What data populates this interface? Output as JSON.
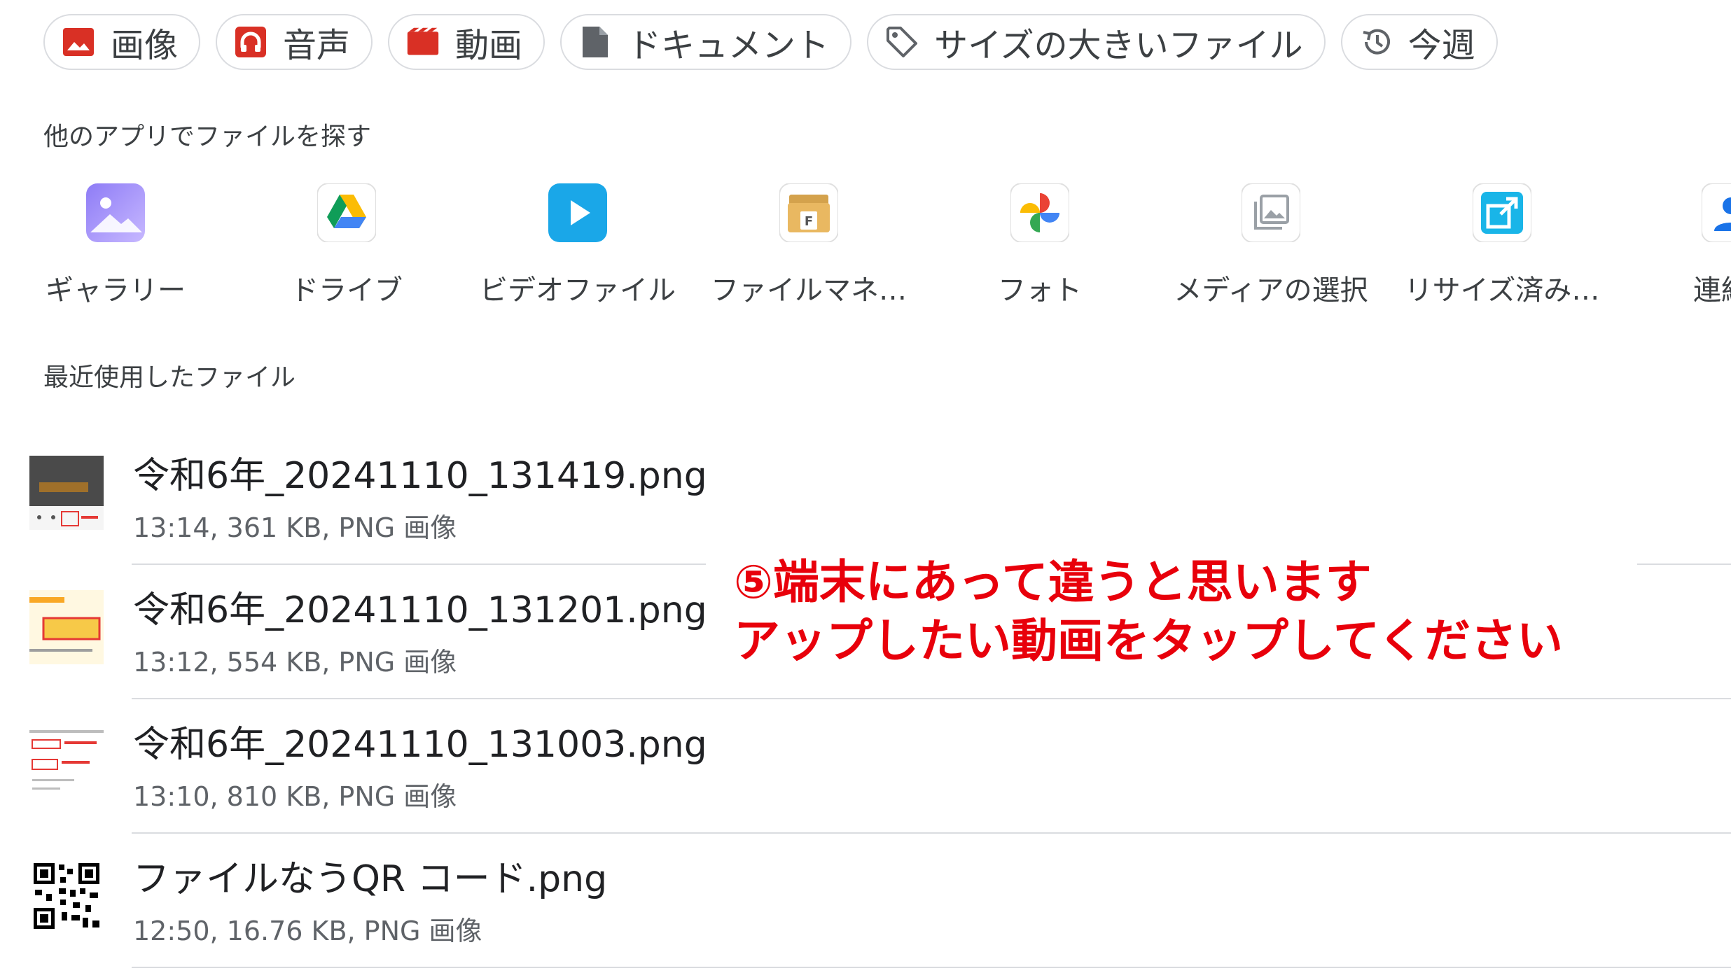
{
  "chips": [
    {
      "label": "画像",
      "icon": "image-icon"
    },
    {
      "label": "音声",
      "icon": "headphones-icon"
    },
    {
      "label": "動画",
      "icon": "video-icon"
    },
    {
      "label": "ドキュメント",
      "icon": "document-icon"
    },
    {
      "label": "サイズの大きいファイル",
      "icon": "tag-icon"
    },
    {
      "label": "今週",
      "icon": "history-icon"
    }
  ],
  "other_apps": {
    "title": "他のアプリでファイルを探す",
    "apps": [
      {
        "label": "ギャラリー",
        "icon": "gallery-icon"
      },
      {
        "label": "ドライブ",
        "icon": "google-drive-icon"
      },
      {
        "label": "ビデオファイル",
        "icon": "video-player-icon"
      },
      {
        "label": "ファイルマネ…",
        "icon": "file-manager-icon"
      },
      {
        "label": "フォト",
        "icon": "google-photos-icon"
      },
      {
        "label": "メディアの選択",
        "icon": "media-picker-icon"
      },
      {
        "label": "リサイズ済み…",
        "icon": "resize-icon"
      },
      {
        "label": "連絡",
        "icon": "contacts-icon"
      }
    ]
  },
  "recent": {
    "title": "最近使用したファイル",
    "files": [
      {
        "name": "令和6年_20241110_131419.png",
        "meta": "13:14, 361 KB, PNG 画像"
      },
      {
        "name": "令和6年_20241110_131201.png",
        "meta": "13:12, 554 KB, PNG 画像"
      },
      {
        "name": "令和6年_20241110_131003.png",
        "meta": "13:10, 810 KB, PNG 画像"
      },
      {
        "name": "ファイルなうQR コード.png",
        "meta": "12:50, 16.76 KB, PNG 画像"
      }
    ]
  },
  "annotation": {
    "line1": "⑤端末にあって違うと思います",
    "line2": "アップしたい動画をタップしてください"
  },
  "colors": {
    "chip_red": "#d93025",
    "chip_gray": "#5f6368",
    "annotation_red": "#e8000b"
  }
}
